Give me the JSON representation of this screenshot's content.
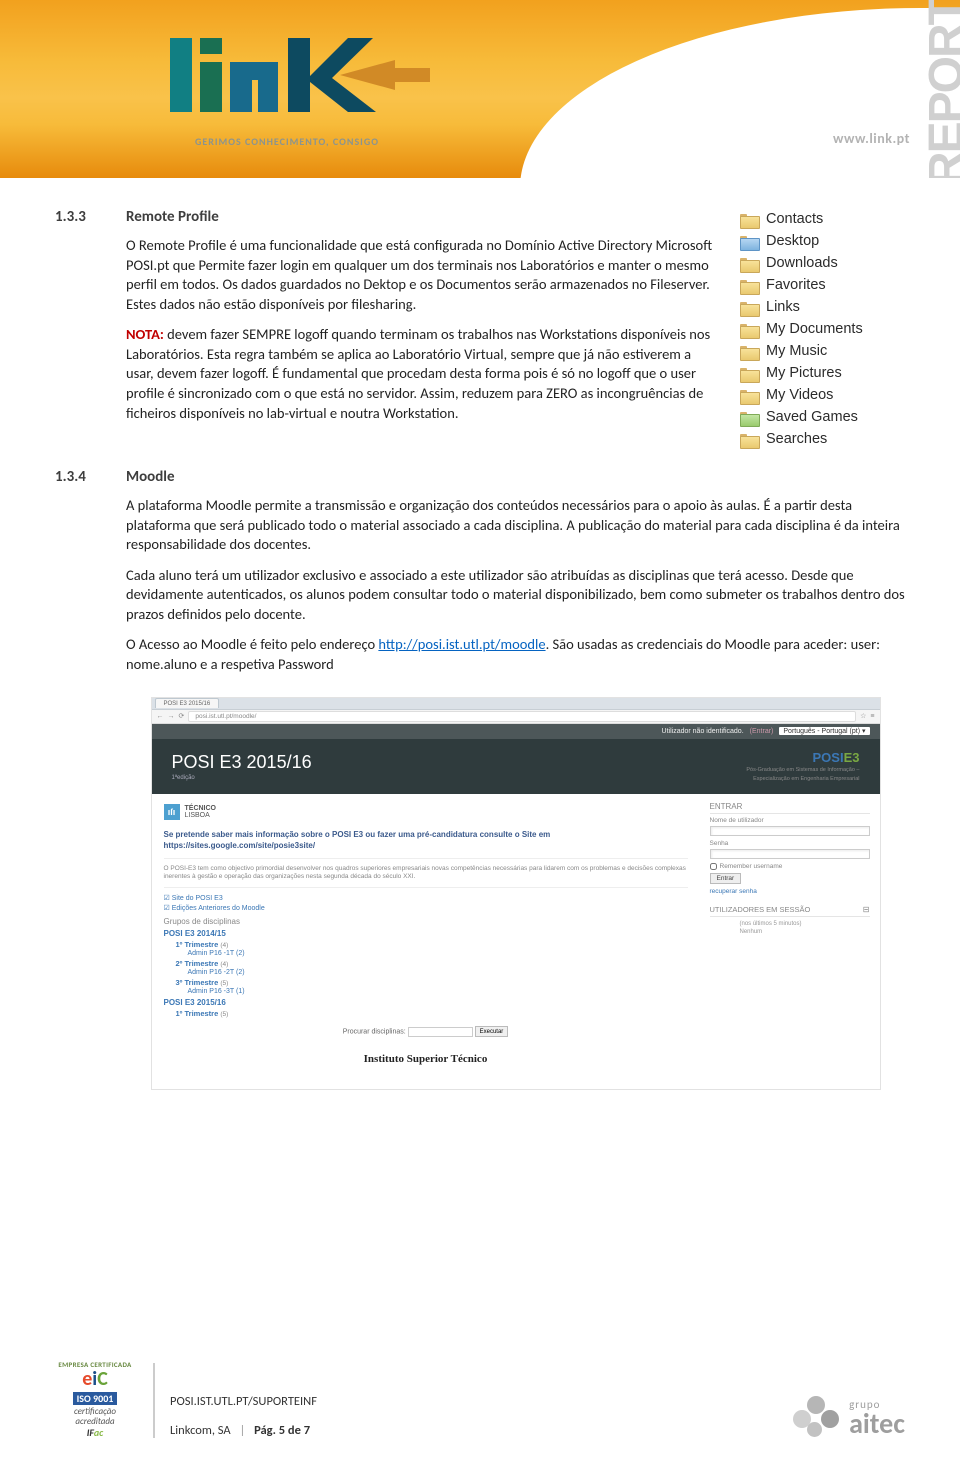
{
  "header": {
    "tagline": "GERIMOS CONHECIMENTO, CONSIGO",
    "url": "www.link.pt",
    "side_text": "REPORT"
  },
  "sections": {
    "remote": {
      "num": "1.3.3",
      "title": "Remote Profile",
      "p1": "O Remote Profile é uma funcionalidade que está configurada no Domínio Active Directory Microsoft POSI.pt que Permite fazer login em qualquer um dos terminais nos Laboratórios e manter o mesmo perfil em todos. Os dados guardados no Dektop e os Documentos serão armazenados no Fileserver. Estes dados não estão disponíveis por filesharing.",
      "nota_label": "NOTA:",
      "p2_rest": " devem fazer SEMPRE logoff quando terminam os trabalhos nas Workstations disponíveis nos Laboratórios. Esta regra também se aplica ao Laboratório Virtual, sempre que já não estiverem a usar, devem fazer logoff. É fundamental que procedam desta forma pois é só no logoff que o user profile é sincronizado com o que está no servidor. Assim, reduzem para ZERO as incongruências de ficheiros disponíveis no lab-virtual e noutra Workstation."
    },
    "moodle": {
      "num": "1.3.4",
      "title": "Moodle",
      "p1": "A plataforma Moodle permite a transmissão e organização dos conteúdos necessários para o apoio às aulas. É a partir desta plataforma que será publicado todo o material associado a cada disciplina. A publicação do material para cada disciplina é da inteira responsabilidade dos docentes.",
      "p2": "Cada aluno terá um utilizador exclusivo e associado a este utilizador são atribuídas as disciplinas que terá acesso. Desde que devidamente autenticados, os alunos podem consultar todo o material disponibilizado, bem como submeter os trabalhos dentro dos prazos definidos pelo docente.",
      "p3_a": "O Acesso ao Moodle é feito pelo endereço ",
      "p3_link": "http://posi.ist.utl.pt/moodle",
      "p3_b": ". São usadas as credenciais do Moodle para aceder: user: nome.aluno e a respetiva Password"
    }
  },
  "folders": [
    {
      "label": "Contacts",
      "variant": "default"
    },
    {
      "label": "Desktop",
      "variant": "blue"
    },
    {
      "label": "Downloads",
      "variant": "default"
    },
    {
      "label": "Favorites",
      "variant": "default"
    },
    {
      "label": "Links",
      "variant": "default"
    },
    {
      "label": "My Documents",
      "variant": "default"
    },
    {
      "label": "My Music",
      "variant": "default"
    },
    {
      "label": "My Pictures",
      "variant": "default"
    },
    {
      "label": "My Videos",
      "variant": "default"
    },
    {
      "label": "Saved Games",
      "variant": "green"
    },
    {
      "label": "Searches",
      "variant": "default"
    }
  ],
  "moodle_shot": {
    "tab": "POSI E3 2015/16",
    "addr_url": "posi.ist.utl.pt/moodle/",
    "top_user": "Utilizador não identificado.",
    "top_login": "(Entrar)",
    "top_lang": "Português - Portugal (pt) ▾",
    "title": "POSI E3 2015/16",
    "subtitle": "1ªedição",
    "posi_logo_a": "POSI",
    "posi_logo_b": "E3",
    "posi_sub1": "Pós-Graduação em Sistemas de Informação –",
    "posi_sub2": "Especialização em Engenharia Empresarial",
    "tecnico": "TÉCNICO",
    "lisboa": "LISBOA",
    "notice": "Se pretende saber mais informação sobre o POSI E3 ou fazer uma pré-candidatura consulte o Site em ",
    "notice_url": "https://sites.google.com/site/posie3site/",
    "desc": "O POSI-E3 tem como objectivo primordial desenvolver nos quadros superiores empresariais novas competências necessárias para lidarem com os problemas e decisões complexas inerentes à gestão e operação das organizações nesta segunda década do século XXI.",
    "check1": "Site do POSI E3",
    "check2": "Edições Anteriores do Moodle",
    "groups_h": "Grupos de disciplinas",
    "courses": [
      {
        "name": "POSI E3 2014/15",
        "trimestres": [
          {
            "label": "1º Trimestre",
            "count": "(4)",
            "admins": [
              "Admin P16 -1T (2)"
            ]
          },
          {
            "label": "2º Trimestre",
            "count": "(4)",
            "admins": [
              "Admin P16 -2T (2)"
            ]
          },
          {
            "label": "3º Trimestre",
            "count": "(5)",
            "admins": [
              "Admin P16 -3T (1)"
            ]
          }
        ]
      },
      {
        "name": "POSI E3 2015/16",
        "trimestres": [
          {
            "label": "1º Trimestre",
            "count": "(5)",
            "admins": []
          }
        ]
      }
    ],
    "search_label": "Procurar disciplinas:",
    "search_btn": "Executar",
    "ist": "Instituto Superior Técnico",
    "login": {
      "heading": "ENTRAR",
      "user_label": "Nome de utilizador",
      "pass_label": "Senha",
      "remember": "Remember username",
      "enter": "Entrar",
      "forgot": "recuperar senha",
      "sess_heading": "UTILIZADORES EM SESSÃO",
      "sess_body1": "(nos últimos 5 minutos)",
      "sess_body2": "Nenhum"
    }
  },
  "footer": {
    "doc_ref": "POSI.IST.UTL.PT/SUPORTEINF",
    "company": "Linkcom, SA",
    "page_label": "Pág. 5 de 7",
    "eic": {
      "top": "EMPRESA CERTIFICADA",
      "iso": "ISO 9001",
      "cert1": "certificação",
      "cert2": "acreditada"
    },
    "aitec": {
      "top": "grupo",
      "name": "aitec"
    }
  }
}
